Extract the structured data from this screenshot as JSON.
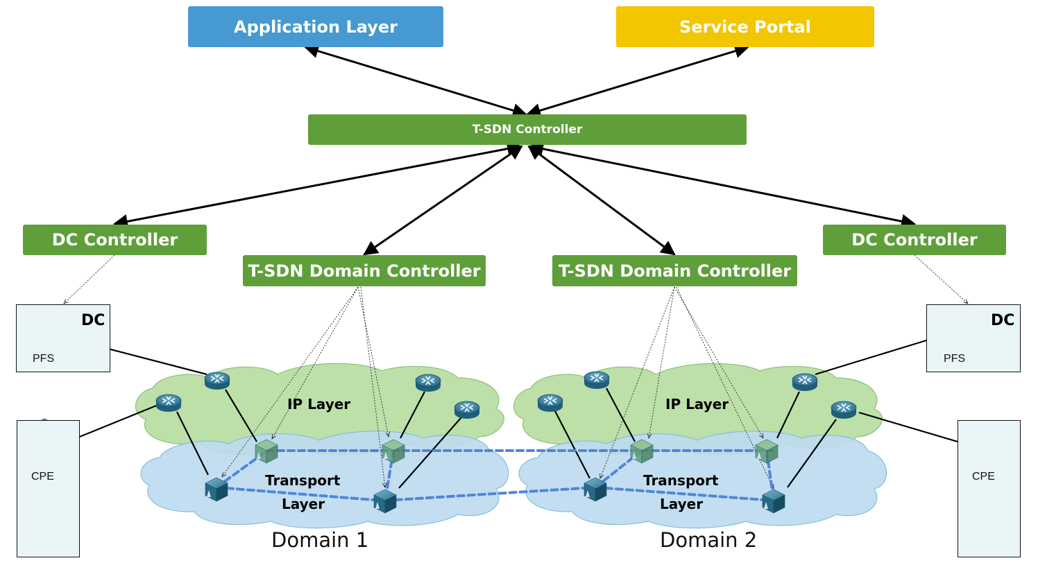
{
  "title_boxes": {
    "application_layer": "Application Layer",
    "service_portal": "Service Portal",
    "tsdn_controller": "T-SDN Controller",
    "dc_controller_left": "DC Controller",
    "dc_controller_right": "DC Controller",
    "domain_controller_1": "T-SDN Domain Controller",
    "domain_controller_2": "T-SDN Domain Controller"
  },
  "sites": {
    "dc_left": {
      "title": "DC",
      "device": "PFS"
    },
    "dc_right": {
      "title": "DC",
      "device": "PFS"
    },
    "cpe_left": {
      "device": "CPE"
    },
    "cpe_right": {
      "device": "CPE"
    }
  },
  "domains": [
    {
      "name": "Domain 1",
      "ip_layer": "IP Layer",
      "transport_layer_1": "Transport",
      "transport_layer_2": "Layer"
    },
    {
      "name": "Domain 2",
      "ip_layer": "IP Layer",
      "transport_layer_1": "Transport",
      "transport_layer_2": "Layer"
    }
  ],
  "colors": {
    "application": "#4699d1",
    "portal": "#f2c600",
    "controller": "#5e9f3a",
    "ip_cloud": "#bde0a9",
    "transport_cloud": "#c0dcef",
    "optical_link": "#4f86d6"
  }
}
